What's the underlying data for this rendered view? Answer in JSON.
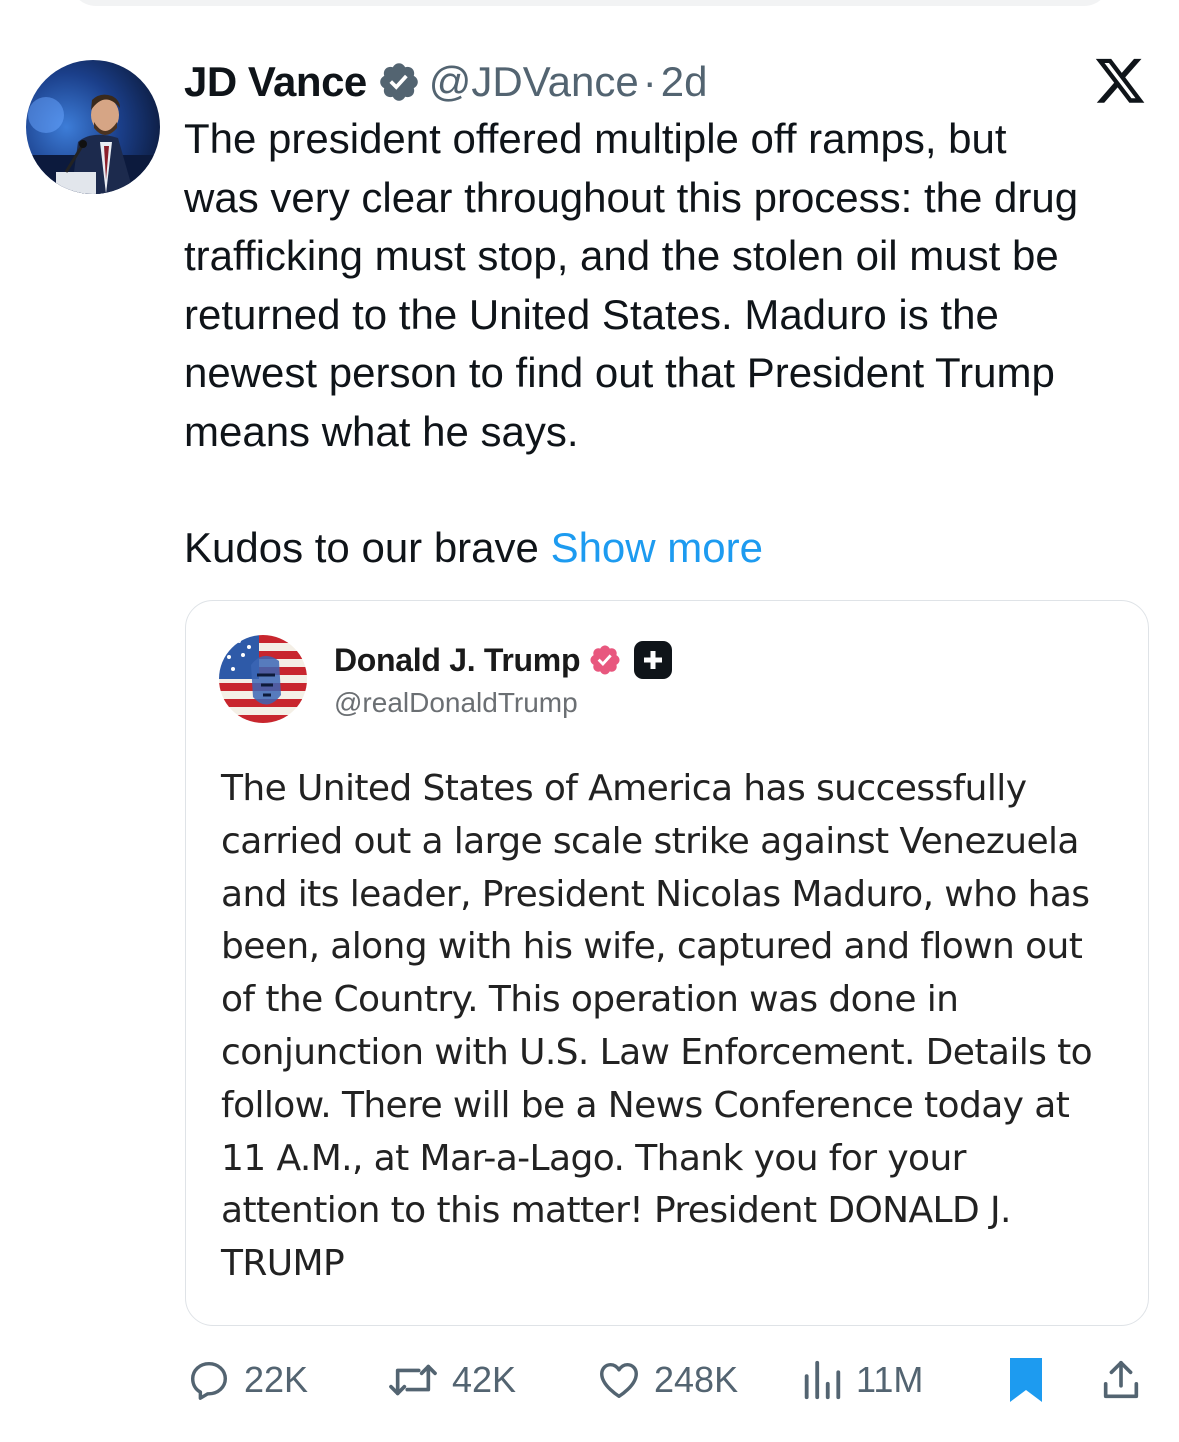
{
  "tweet": {
    "author_name": "JD Vance",
    "handle": "@JDVance",
    "separator": "·",
    "time": "2d",
    "text_lines": [
      "The president offered multiple off ramps, but",
      "was very clear throughout this process: the drug",
      "trafficking must stop, and the stolen oil must be",
      "returned to the United States. Maduro is the",
      "newest person to find out that President Trump",
      "means what he says."
    ],
    "kudos_text": "Kudos to our brave",
    "show_more": "Show more"
  },
  "quote": {
    "author_name": "Donald J. Trump",
    "handle": "@realDonaldTrump",
    "text_lines": [
      "The United States of America has successfully",
      "carried out a large scale strike against Venezuela",
      "and its leader, President Nicolas Maduro, who has",
      "been, along with his wife, captured and flown out",
      "of the Country. This operation was done in",
      "conjunction with U.S. Law Enforcement. Details to",
      "follow. There will be a News Conference today at",
      "11 A.M., at Mar-a-Lago. Thank you for your",
      "attention to this matter! President DONALD J.",
      "TRUMP"
    ]
  },
  "actions": {
    "replies": "22K",
    "reposts": "42K",
    "likes": "248K",
    "views": "11M"
  },
  "icons": {
    "verified": "verified-badge-icon",
    "x": "x-logo-icon",
    "reply": "reply-icon",
    "repost": "repost-icon",
    "like": "heart-icon",
    "views": "views-icon",
    "bookmark": "bookmark-icon",
    "share": "share-icon"
  },
  "colors": {
    "accent": "#1d9bf0",
    "text": "#0f1419",
    "secondary": "#536471",
    "quote_verified": "#e8577e"
  }
}
